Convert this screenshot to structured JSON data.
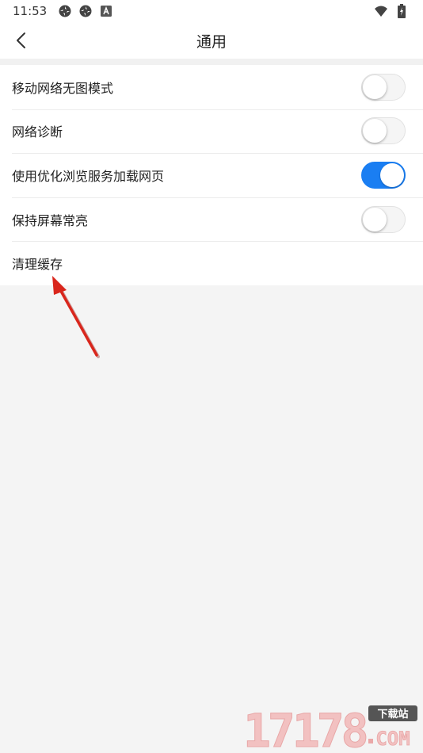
{
  "status_bar": {
    "time": "11:53",
    "left_icons": [
      "sync-icon",
      "sync-icon",
      "notification-a-icon"
    ],
    "right_icons": [
      "wifi-icon",
      "battery-charging-icon"
    ]
  },
  "header": {
    "title": "通用",
    "back_icon": "chevron-left-icon"
  },
  "settings": {
    "items": [
      {
        "label": "移动网络无图模式",
        "toggle": true,
        "on": false
      },
      {
        "label": "网络诊断",
        "toggle": true,
        "on": false
      },
      {
        "label": "使用优化浏览服务加载网页",
        "toggle": true,
        "on": true
      },
      {
        "label": "保持屏幕常亮",
        "toggle": true,
        "on": false
      },
      {
        "label": "清理缓存",
        "toggle": false
      }
    ]
  },
  "colors": {
    "accent": "#1a7ef2",
    "background": "#f4f4f4",
    "annotation_arrow": "#d9261c"
  },
  "watermark": {
    "number": "17178",
    "badge": "下载站",
    "suffix": "COM"
  }
}
